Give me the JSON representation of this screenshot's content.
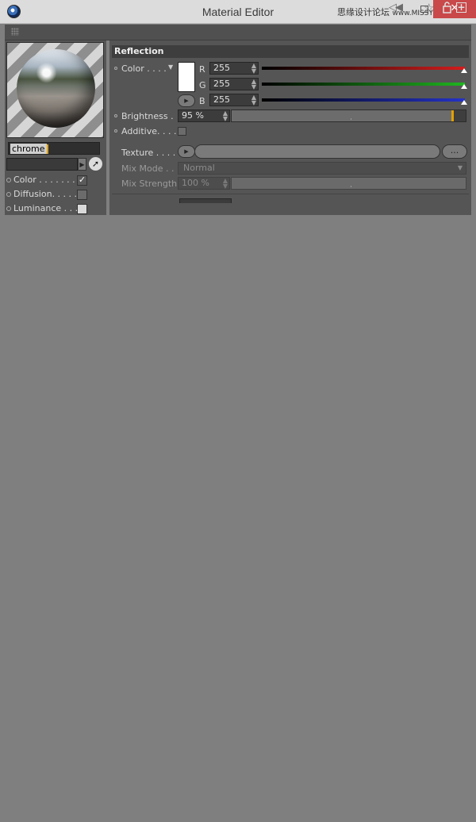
{
  "window": {
    "title": "Material Editor",
    "watermark_cn": "思缘设计论坛",
    "watermark_url": "www.MISSYUAN.com",
    "close_label": "✕"
  },
  "material": {
    "name": "chrome"
  },
  "channels": [
    {
      "label": "Color . . . . . . . .",
      "checked": true
    },
    {
      "label": "Diffusion. . . . .",
      "checked": false
    },
    {
      "label": "Luminance . . .",
      "checked": false
    }
  ],
  "reflection": {
    "section_title": "Reflection",
    "color_label": "Color . . . .",
    "swatch_color": "#ffffff",
    "r_label": "R",
    "r_value": "255",
    "g_label": "G",
    "g_value": "255",
    "b_label": "B",
    "b_value": "255",
    "brightness_label": "Brightness .",
    "brightness_value": "95 %",
    "brightness_fraction": 0.95,
    "additive_label": "Additive. . . .",
    "texture_label": "Texture  . . . .",
    "texture_more_label": "...",
    "mix_mode_label": "Mix Mode . .",
    "mix_mode_value": "Normal",
    "mix_strength_label": "Mix Strength",
    "mix_strength_value": "100 %"
  },
  "colors": {
    "red": "#d41c1c",
    "green": "#1fb51f",
    "blue": "#2432c8",
    "accent": "#e3a000"
  }
}
